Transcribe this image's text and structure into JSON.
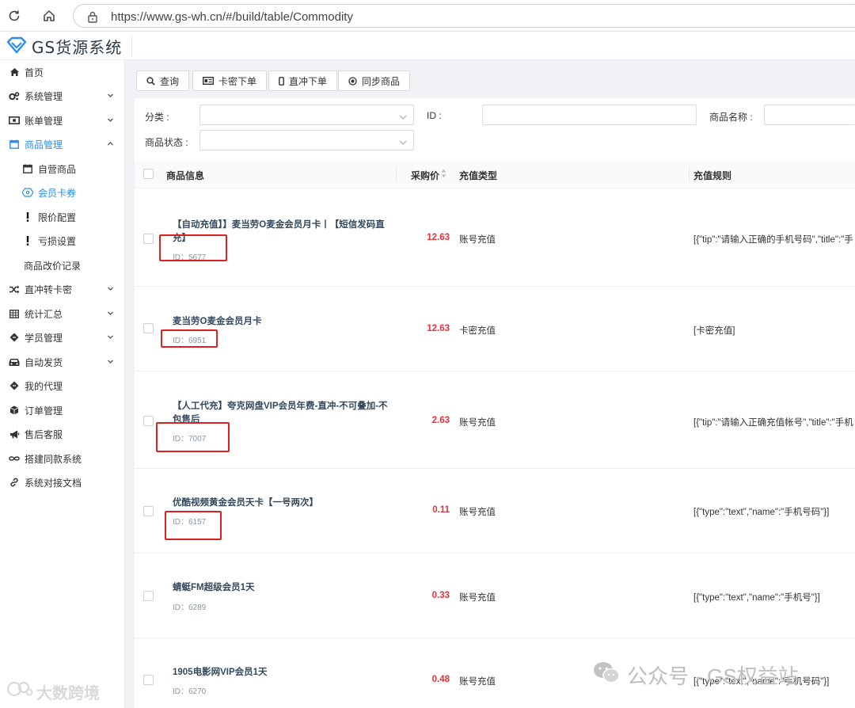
{
  "browser": {
    "url": "https://www.gs-wh.cn/#/build/table/Commodity"
  },
  "app": {
    "title": "GS货源系统"
  },
  "sidebar": {
    "items": [
      {
        "label": "首页",
        "icon": "home-icon"
      },
      {
        "label": "系统管理",
        "icon": "gears-icon",
        "expandable": true
      },
      {
        "label": "账单管理",
        "icon": "money-icon",
        "expandable": true
      },
      {
        "label": "商品管理",
        "icon": "calendar-icon",
        "expandable": true,
        "expanded": true
      },
      {
        "label": "自营商品",
        "icon": "calendar-small-icon",
        "sub": true
      },
      {
        "label": "会员卡券",
        "icon": "network-icon",
        "sub": true,
        "active": true
      },
      {
        "label": "限价配置",
        "icon": "exclamation-icon",
        "sub": true
      },
      {
        "label": "亏损设置",
        "icon": "exclamation-icon",
        "sub": true
      },
      {
        "label": "商品改价记录",
        "sub": true
      },
      {
        "label": "直冲转卡密",
        "icon": "shuffle-icon",
        "expandable": true
      },
      {
        "label": "统计汇总",
        "icon": "table-icon",
        "expandable": true
      },
      {
        "label": "学员管理",
        "icon": "ticket-icon",
        "expandable": true
      },
      {
        "label": "自动发货",
        "icon": "car-icon",
        "expandable": true
      },
      {
        "label": "我的代理",
        "icon": "ticket-icon"
      },
      {
        "label": "订单管理",
        "icon": "cube-icon"
      },
      {
        "label": "售后客服",
        "icon": "megaphone-icon"
      },
      {
        "label": "搭建同款系统",
        "icon": "infinity-icon"
      },
      {
        "label": "系统对接文档",
        "icon": "link-icon"
      }
    ]
  },
  "toolbar": {
    "query": "查询",
    "card_order": "卡密下单",
    "direct_order": "直冲下单",
    "sync": "同步商品"
  },
  "filters": {
    "category_label": "分类 :",
    "id_label": "ID :",
    "name_label": "商品名称 :",
    "status_label": "商品状态 :"
  },
  "table": {
    "columns": [
      "商品信息",
      "采购价",
      "充值类型",
      "充值规则"
    ],
    "rows": [
      {
        "name_line1": "【自动充值】】麦当劳O麦金会员月卡丨【短信发码直",
        "name_line2": "充】",
        "id": "ID：5677",
        "price": "12.63",
        "type": "账号充值",
        "rule": "[{\"tip\":\"请输入正确的手机号码\",\"title\":\"手"
      },
      {
        "name_line1": "麦当劳O麦金会员月卡",
        "name_line2": "",
        "id": "ID：6951",
        "price": "12.63",
        "type": "卡密充值",
        "rule": "[卡密充值]"
      },
      {
        "name_line1": "【人工代充】夸克网盘VIP会员年费-直冲-不可叠加-不",
        "name_line2": "包售后",
        "id": "ID：7007",
        "price": "2.63",
        "type": "账号充值",
        "rule": "[{\"tip\":\"请输入正确充值帐号\",\"title\":\"手机"
      },
      {
        "name_line1": "优酷视频黄金会员天卡【一号两次】",
        "name_line2": "",
        "id": "ID：6157",
        "price": "0.11",
        "type": "账号充值",
        "rule": "[{\"type\":\"text\",\"name\":\"手机号码\"}]"
      },
      {
        "name_line1": "蜻蜓FM超级会员1天",
        "name_line2": "",
        "id": "ID：6289",
        "price": "0.33",
        "type": "账号充值",
        "rule": "[{\"type\":\"text\",\"name\":\"手机号\"}]"
      },
      {
        "name_line1": "1905电影网VIP会员1天",
        "name_line2": "",
        "id": "ID：6270",
        "price": "0.48",
        "type": "账号充值",
        "rule": "[{\"type\":\"text\",\"name\":\"手机号码\"}]"
      }
    ]
  },
  "watermarks": {
    "left": "大数跨境",
    "right": "公众号 · GS权益站"
  },
  "colors": {
    "accent": "#2d8cf0",
    "price": "#e8303a",
    "highlight_box": "#e0201e"
  }
}
